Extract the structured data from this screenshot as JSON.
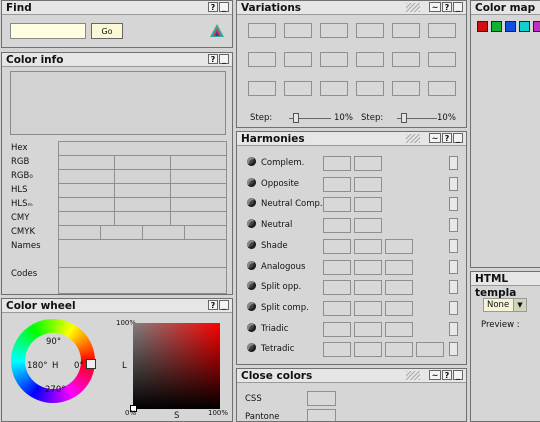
{
  "find": {
    "title": "Find",
    "go_label": "Go",
    "input_value": ""
  },
  "colorinfo": {
    "title": "Color info",
    "labels": [
      "Hex",
      "RGB",
      "RGB₀",
      "HLS",
      "HLSₘ",
      "CMY",
      "CMYK",
      "Names",
      "Codes"
    ]
  },
  "colorwheel": {
    "title": "Color wheel",
    "deg90": "90°",
    "deg180": "180°",
    "deg0": "0°",
    "deg270": "270°",
    "h": "H",
    "l": "L",
    "s": "S",
    "pct100_top": "100%",
    "pct100_right": "100%",
    "pct0": "0%"
  },
  "variations": {
    "title": "Variations",
    "step_label1": "Step:",
    "step_value1": "10%",
    "step_label2": "Step:",
    "step_value2": "10%"
  },
  "harmonies": {
    "title": "Harmonies",
    "items": [
      "Complem.",
      "Opposite",
      "Neutral Comp.",
      "Neutral",
      "Shade",
      "Analogous",
      "Split opp.",
      "Split comp.",
      "Triadic",
      "Tetradic"
    ]
  },
  "closecolors": {
    "title": "Close colors",
    "items": [
      "CSS",
      "Pantone"
    ]
  },
  "colormap": {
    "title": "Color map",
    "swatches": [
      "#d01010",
      "#10b030",
      "#1050e0",
      "#10d0d0",
      "#c030c0"
    ]
  },
  "htmltemplate": {
    "title": "HTML templa",
    "select_value": "None",
    "preview_label": "Preview :"
  },
  "btn": {
    "help": "?",
    "min": "_"
  }
}
